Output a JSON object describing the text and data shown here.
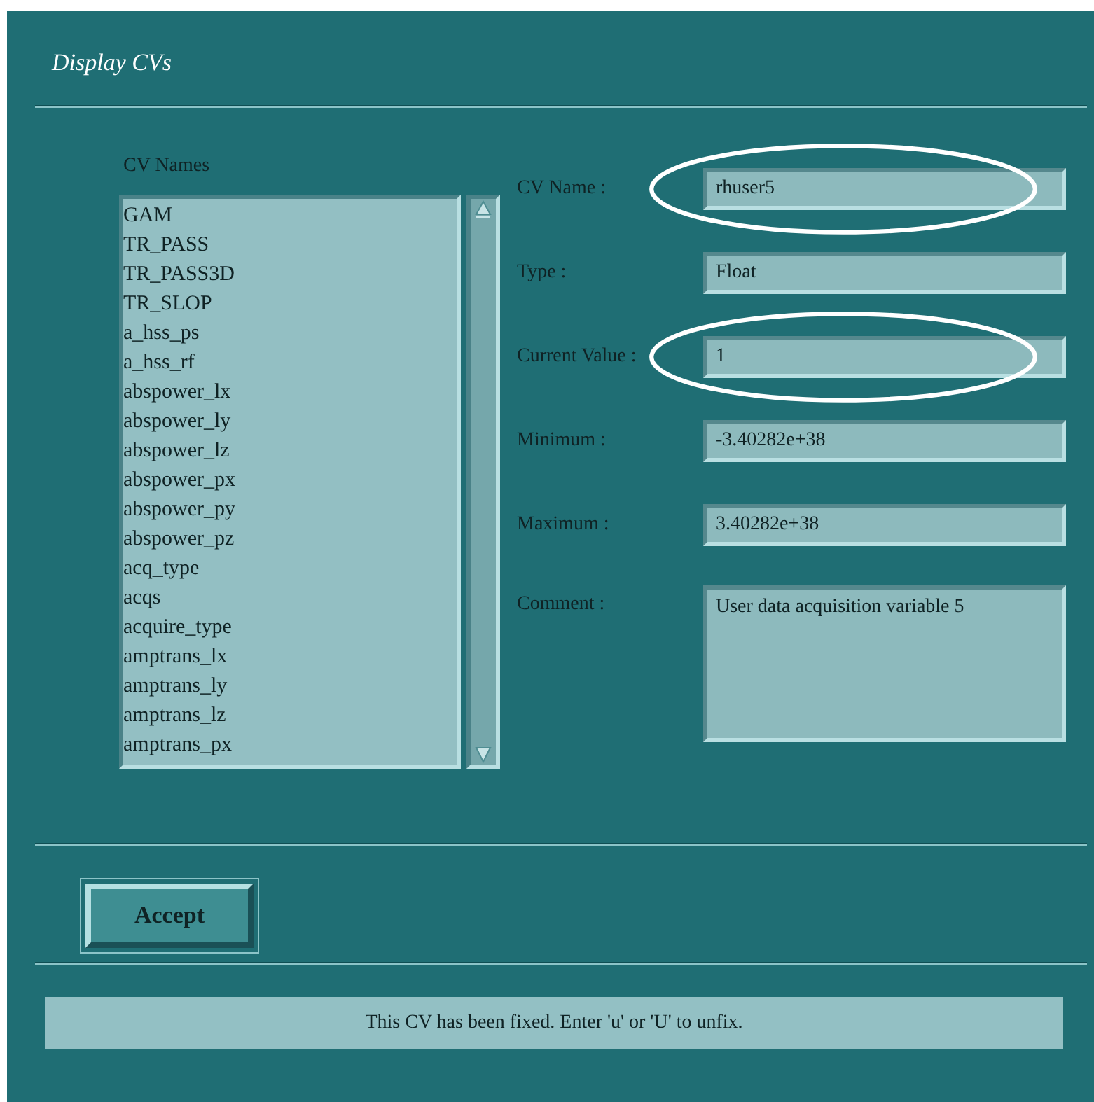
{
  "window": {
    "title": "Display CVs"
  },
  "cv_list": {
    "label": "CV Names",
    "items": [
      "GAM",
      "TR_PASS",
      "TR_PASS3D",
      "TR_SLOP",
      "a_hss_ps",
      "a_hss_rf",
      "abspower_lx",
      "abspower_ly",
      "abspower_lz",
      "abspower_px",
      "abspower_py",
      "abspower_pz",
      "acq_type",
      "acqs",
      "acquire_type",
      "amptrans_lx",
      "amptrans_ly",
      "amptrans_lz",
      "amptrans_px"
    ]
  },
  "fields": [
    {
      "label": "CV Name :",
      "value": "rhuser5",
      "kind": "line",
      "circled": true
    },
    {
      "label": "Type :",
      "value": "Float",
      "kind": "line",
      "circled": false
    },
    {
      "label": "Current Value :",
      "value": "1",
      "kind": "line",
      "circled": true
    },
    {
      "label": "Minimum :",
      "value": "-3.40282e+38",
      "kind": "line",
      "circled": false
    },
    {
      "label": "Maximum :",
      "value": "3.40282e+38",
      "kind": "line",
      "circled": false
    },
    {
      "label": "Comment :",
      "value": "User data acquisition variable 5",
      "kind": "area",
      "circled": false
    }
  ],
  "buttons": [
    "Accept"
  ],
  "status_bar": "This CV has been fixed.  Enter 'u' or 'U' to unfix."
}
